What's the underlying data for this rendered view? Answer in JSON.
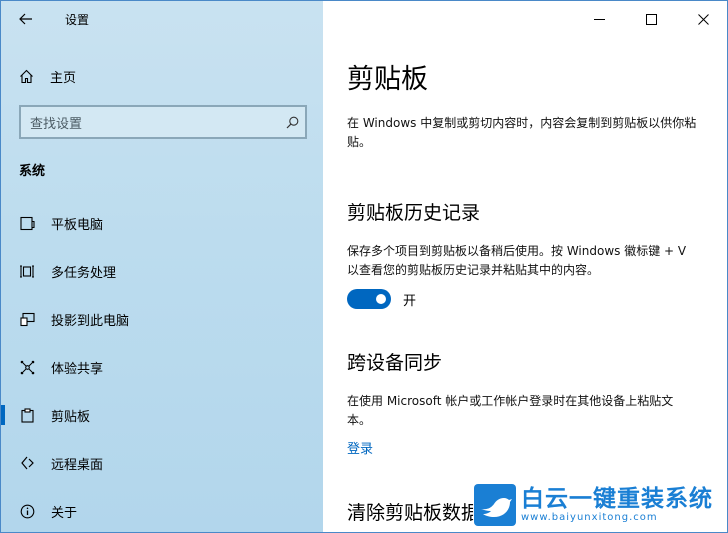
{
  "window": {
    "title": "设置"
  },
  "sidebar": {
    "home_label": "主页",
    "search_placeholder": "查找设置",
    "section_title": "系统",
    "items": [
      {
        "label": "平板电脑",
        "icon": "tablet-icon"
      },
      {
        "label": "多任务处理",
        "icon": "multitasking-icon"
      },
      {
        "label": "投影到此电脑",
        "icon": "project-icon"
      },
      {
        "label": "体验共享",
        "icon": "shared-experiences-icon"
      },
      {
        "label": "剪贴板",
        "icon": "clipboard-icon",
        "active": true
      },
      {
        "label": "远程桌面",
        "icon": "remote-desktop-icon"
      },
      {
        "label": "关于",
        "icon": "info-icon"
      }
    ]
  },
  "main": {
    "title": "剪贴板",
    "intro": "在 Windows 中复制或剪切内容时，内容会复制到剪贴板以供你粘贴。",
    "history": {
      "heading": "剪贴板历史记录",
      "description": "保存多个项目到剪贴板以备稍后使用。按 Windows 徽标键 + V 以查看您的剪贴板历史记录并粘贴其中的内容。",
      "toggle_state": "开",
      "toggle_on": true
    },
    "sync": {
      "heading": "跨设备同步",
      "description": "在使用 Microsoft 帐户或工作帐户登录时在其他设备上粘贴文本。",
      "link": "登录"
    },
    "clear": {
      "heading": "清除剪贴板数据"
    }
  },
  "watermark": {
    "brand": "白云一键重装系统",
    "url": "www.baiyunxitong.com"
  },
  "colors": {
    "accent": "#0067c0",
    "sidebar_bg": "#bcdcee"
  }
}
